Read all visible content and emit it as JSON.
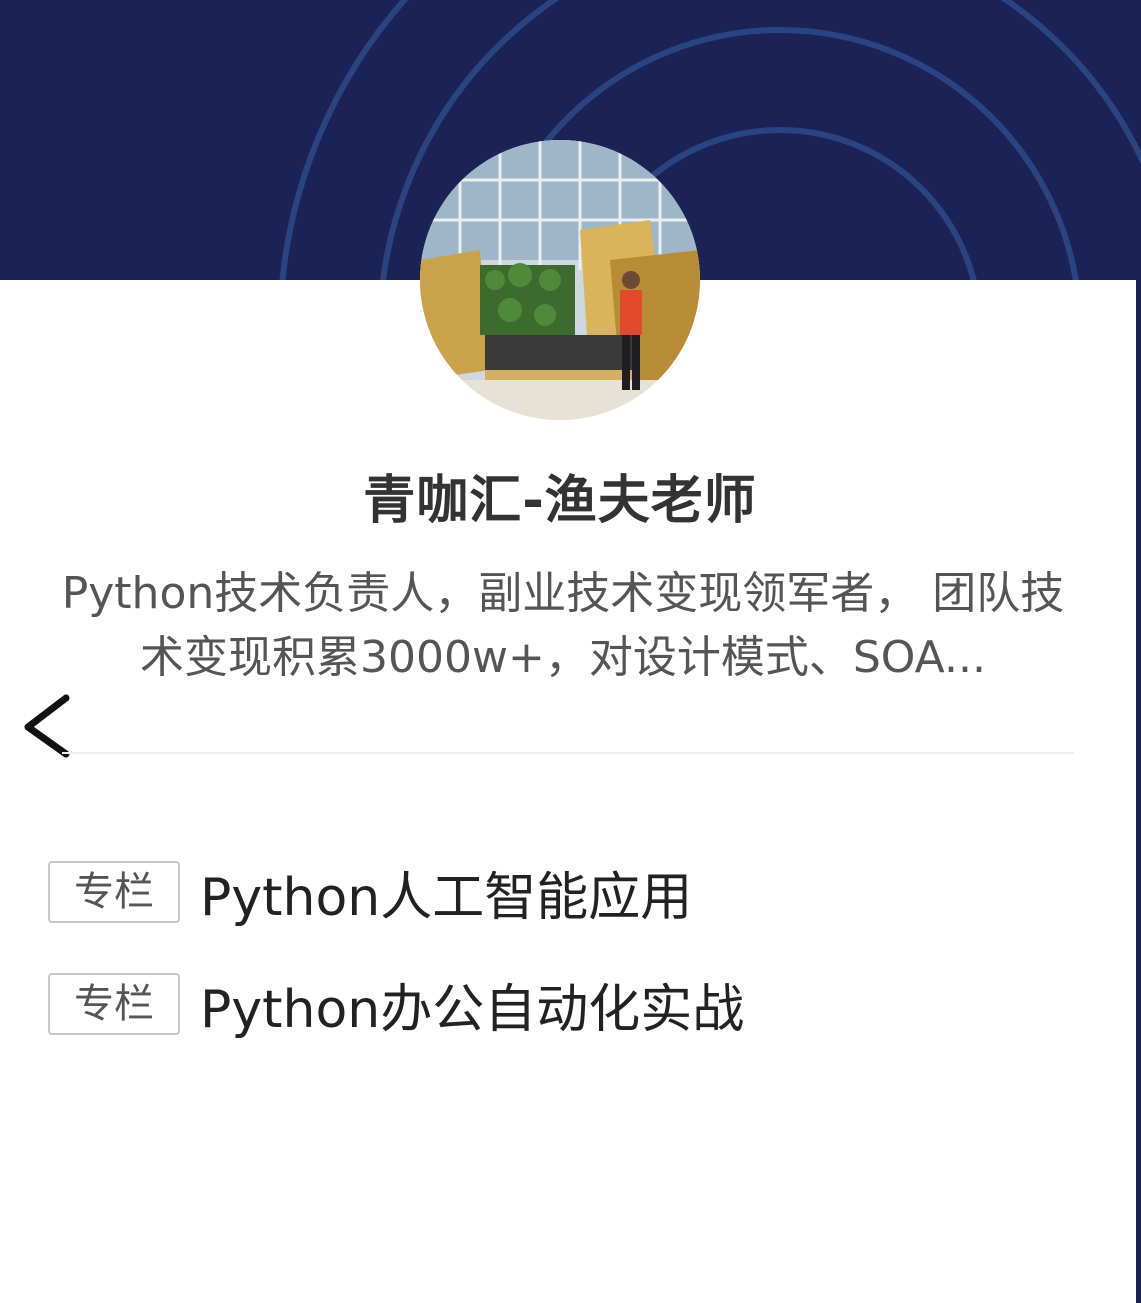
{
  "profile": {
    "name": "青咖汇-渔夫老师",
    "bio": "Python技术负责人，副业技术变现领军者， 团队技术变现积累3000w+，对设计模式、SOA..."
  },
  "columns": [
    {
      "badge": "专栏",
      "title": "Python人工智能应用"
    },
    {
      "badge": "专栏",
      "title": "Python办公自动化实战"
    }
  ],
  "colors": {
    "banner": "#1b2255",
    "banner_rings": "#2e4a8c",
    "name_text": "#333333",
    "bio_text": "#555555"
  },
  "icons": {
    "back": "chevron-left-icon"
  }
}
